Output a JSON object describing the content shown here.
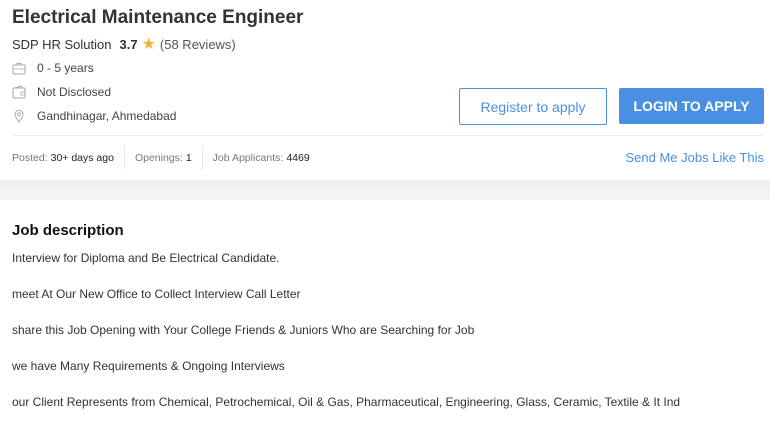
{
  "job": {
    "title": "Electrical Maintenance Engineer",
    "company": "SDP HR Solution",
    "rating": "3.7",
    "reviews": "(58 Reviews)",
    "experience": "0 - 5 years",
    "salary": "Not Disclosed",
    "location": "Gandhinagar, Ahmedabad"
  },
  "actions": {
    "register_label": "Register to apply",
    "login_label": "LOGIN TO APPLY",
    "send_jobs_label": "Send Me Jobs Like This"
  },
  "meta": {
    "posted_label": "Posted:",
    "posted_value": "30+ days ago",
    "openings_label": "Openings:",
    "openings_value": "1",
    "applicants_label": "Job Applicants:",
    "applicants_value": "4469"
  },
  "description": {
    "heading": "Job description",
    "lines": [
      "Interview for Diploma and Be Electrical Candidate.",
      "meet At Our New Office to Collect Interview Call Letter",
      "share this Job Opening with Your College Friends & Juniors Who are Searching for Job",
      "we have Many Requirements & Ongoing Interviews",
      "our Client Represents from Chemical, Petrochemical, Oil & Gas, Pharmaceutical, Engineering, Glass, Ceramic, Textile & It Ind"
    ]
  },
  "colors": {
    "accent": "#4a90e2",
    "star": "#f2b233"
  },
  "icons": {
    "experience": "briefcase-icon",
    "salary": "wallet-icon",
    "location": "location-pin-icon",
    "rating": "star-icon"
  }
}
